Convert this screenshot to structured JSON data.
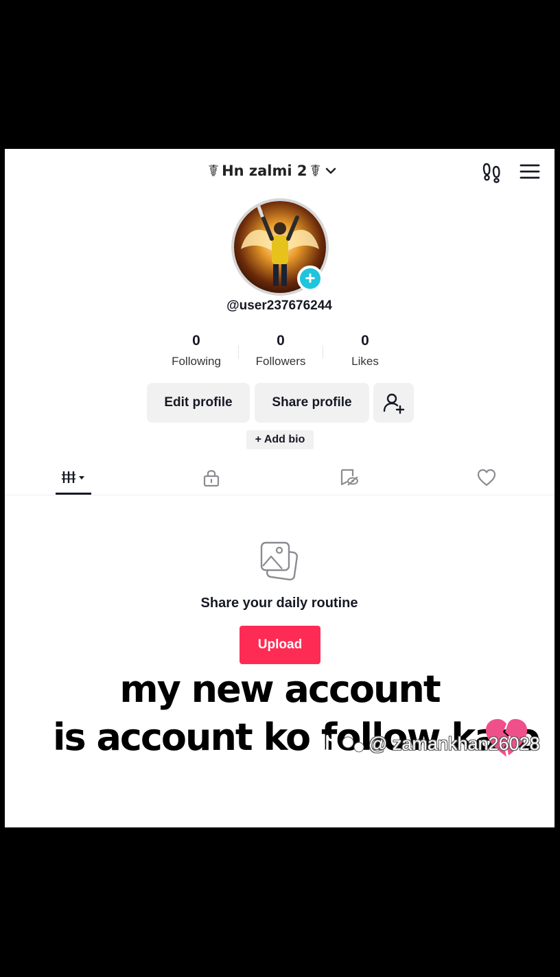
{
  "header": {
    "account_name": "Hn zalmi 2",
    "left_glyph": "☤",
    "right_glyph": "☤",
    "dropdown_icon": "chevron-down-icon",
    "icons": [
      "footprints-icon",
      "menu-icon"
    ]
  },
  "profile": {
    "username": "@user237676244",
    "add_badge": "+",
    "avatar_icon": "avatar-photo"
  },
  "stats": [
    {
      "value": "0",
      "label": "Following"
    },
    {
      "value": "0",
      "label": "Followers"
    },
    {
      "value": "0",
      "label": "Likes"
    }
  ],
  "actions": {
    "edit_profile": "Edit profile",
    "share_profile": "Share profile",
    "add_friends_icon": "add-user-icon"
  },
  "add_bio": "+ Add bio",
  "tabs": [
    {
      "icon": "videos-grid-icon",
      "active": true
    },
    {
      "icon": "lock-icon",
      "active": false
    },
    {
      "icon": "reposts-icon",
      "active": false
    },
    {
      "icon": "heart-outline-icon",
      "active": false
    }
  ],
  "empty_state": {
    "icon": "photos-icon",
    "title": "Share your daily routine",
    "upload_label": "Upload"
  },
  "overlay": {
    "line1": "my new account",
    "line2": "is account ko follow karo",
    "emoji_icon": "broken-heart-icon"
  },
  "watermark": {
    "handle": "@ zamankhan26028",
    "icon": "tiktok-logo-icon"
  },
  "colors": {
    "accent": "#fe2c55",
    "badge": "#20c4dc",
    "text": "#161823",
    "button_bg": "#f1f1f2"
  }
}
